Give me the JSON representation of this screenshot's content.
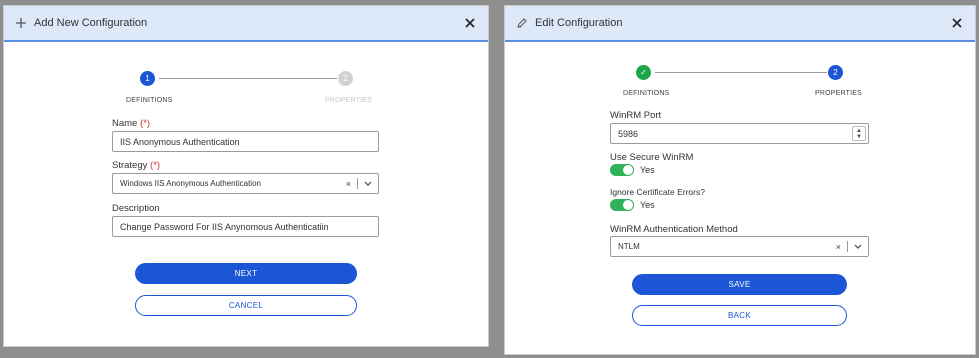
{
  "add_dialog": {
    "title": "Add New Configuration",
    "icon": "plus-icon",
    "steps": [
      {
        "number": "1",
        "label": "DEFINITIONS",
        "state": "active"
      },
      {
        "number": "2",
        "label": "PROPERTIES",
        "state": "inactive"
      }
    ],
    "name_label": "Name",
    "name_required": "(*)",
    "name_value": "IIS Anonymous Authentication",
    "strategy_label": "Strategy",
    "strategy_required": "(*)",
    "strategy_value": "Windows IIS Anonymous Authentication",
    "clear_symbol": "×",
    "description_label": "Description",
    "description_value": "Change Password For IIS Anynomous Authenticatiin",
    "next_label": "NEXT",
    "cancel_label": "CANCEL"
  },
  "edit_dialog": {
    "title": "Edit Configuration",
    "icon": "pencil-icon",
    "steps": [
      {
        "number": "✓",
        "label": "DEFINITIONS",
        "state": "done"
      },
      {
        "number": "2",
        "label": "PROPERTIES",
        "state": "active"
      }
    ],
    "port_label": "WinRM Port",
    "port_value": "5986",
    "secure_label": "Use Secure WinRM",
    "secure_value": "Yes",
    "ignore_cert_label": "Ignore Certificate Errors?",
    "ignore_cert_value": "Yes",
    "auth_label": "WinRM Authentication Method",
    "auth_value": "NTLM",
    "clear_symbol": "×",
    "save_label": "SAVE",
    "back_label": "BACK"
  },
  "colors": {
    "primary": "#1a56d6",
    "success": "#1fa64a",
    "header_bg": "#dde8f9",
    "required": "#d23030"
  }
}
